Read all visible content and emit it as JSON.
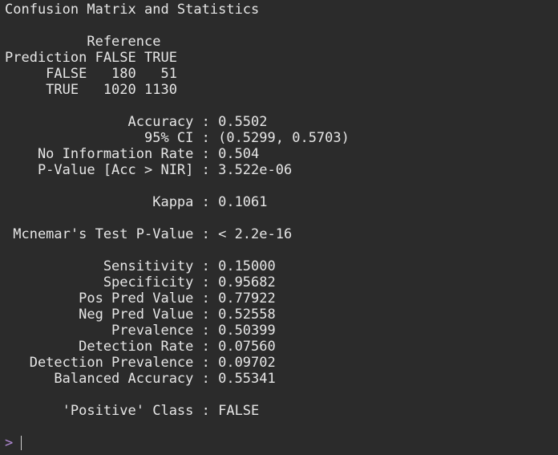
{
  "console": {
    "output_lines": [
      "Confusion Matrix and Statistics",
      "",
      "          Reference",
      "Prediction FALSE TRUE",
      "     FALSE   180   51",
      "     TRUE   1020 1130",
      "",
      "               Accuracy : 0.5502",
      "                 95% CI : (0.5299, 0.5703)",
      "    No Information Rate : 0.504",
      "    P-Value [Acc > NIR] : 3.522e-06",
      "",
      "                  Kappa : 0.1061",
      "",
      " Mcnemar's Test P-Value : < 2.2e-16",
      "",
      "            Sensitivity : 0.15000",
      "            Specificity : 0.95682",
      "         Pos Pred Value : 0.77922",
      "         Neg Pred Value : 0.52558",
      "             Prevalence : 0.50399",
      "         Detection Rate : 0.07560",
      "   Detection Prevalence : 0.09702",
      "      Balanced Accuracy : 0.55341",
      "",
      "       'Positive' Class : FALSE"
    ],
    "prompt": ">",
    "input_value": ""
  },
  "colors": {
    "background": "#2b2b2b",
    "text": "#e6e6e6",
    "prompt": "#b28ad6"
  }
}
